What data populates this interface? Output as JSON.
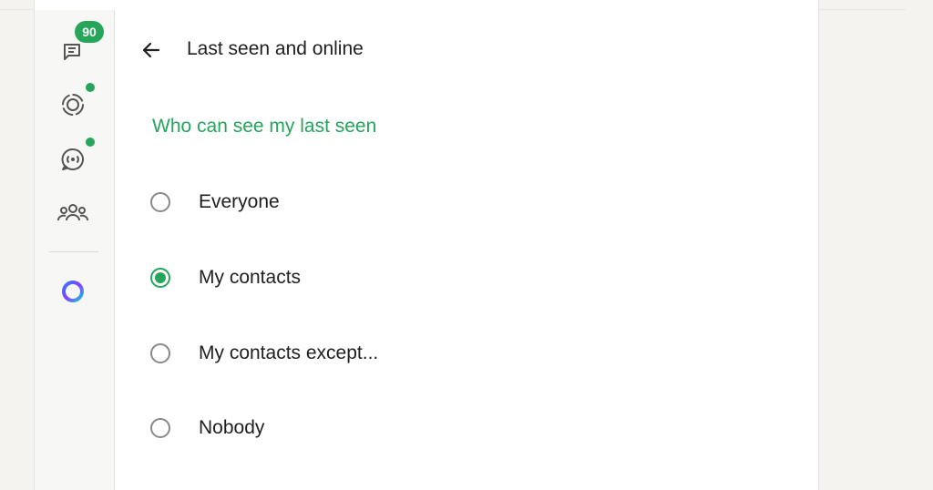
{
  "notifications": {
    "chats_badge": "90"
  },
  "rail": {
    "items": [
      {
        "name": "chats",
        "icon": "chats-icon"
      },
      {
        "name": "status",
        "icon": "status-icon",
        "has_dot": true
      },
      {
        "name": "channels",
        "icon": "channels-icon",
        "has_dot": true
      },
      {
        "name": "communities",
        "icon": "communities-icon"
      },
      {
        "name": "meta-ai",
        "icon": "meta-ai-icon"
      }
    ]
  },
  "header": {
    "back_icon": "arrow-left-icon",
    "title": "Last seen and online"
  },
  "section": {
    "title": "Who can see my last seen"
  },
  "options": [
    {
      "label": "Everyone",
      "selected": false
    },
    {
      "label": "My contacts",
      "selected": true
    },
    {
      "label": "My contacts except...",
      "selected": false
    },
    {
      "label": "Nobody",
      "selected": false
    }
  ],
  "colors": {
    "accent": "#25a65b",
    "text": "#1f1f1f",
    "radio_border": "#8a8a8a"
  }
}
